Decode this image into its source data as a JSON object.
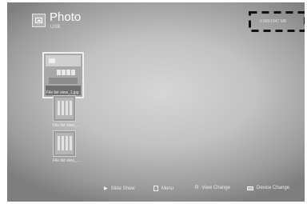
{
  "header": {
    "title": "Photo",
    "subtitle": "USB",
    "app_icon": "photo-icon"
  },
  "storage": {
    "text": "0 MB/1947 MB"
  },
  "thumbnails": [
    {
      "label": "File list view_1.jpg",
      "focused": true
    },
    {
      "label": "File list view_...",
      "focused": false
    },
    {
      "label": "File list view_...",
      "focused": false
    }
  ],
  "bottom_bar": {
    "slide_show": {
      "icon": "play-icon",
      "label": "Slide Show"
    },
    "menu": {
      "icon": "menu-icon",
      "label": "Menu"
    },
    "view_change": {
      "icon": "R",
      "label": "View Change"
    },
    "device_change": {
      "icon": "device-icon",
      "label": "Device Change"
    }
  },
  "colors": {
    "background_center": "#d6d6d6",
    "background_edge": "#7e7e7e",
    "text": "#ffffff"
  }
}
